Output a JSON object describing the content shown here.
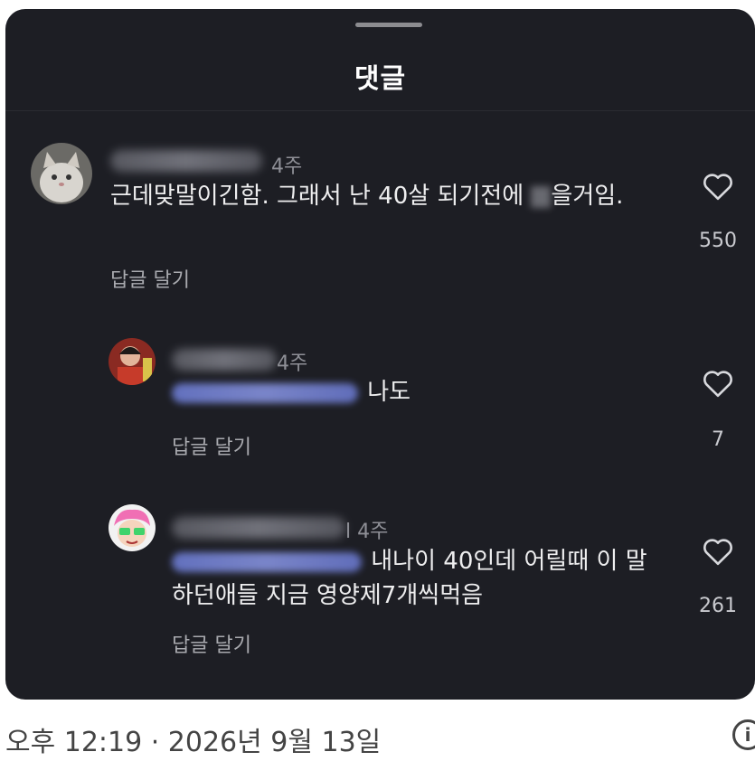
{
  "sheet": {
    "title": "댓글"
  },
  "comments": [
    {
      "time": "4주",
      "text_before": "근데맞말이긴함. 그래서 난 40살 되기전에 ",
      "text_after": "을거임.",
      "reply_label": "답글 달기",
      "likes": "550"
    },
    {
      "time": "4주",
      "text": " 나도",
      "reply_label": "답글 달기",
      "likes": "7"
    },
    {
      "time": "l 4주",
      "text": " 내나이 40인데 어릴때 이 말하던애들 지금 영양제7개씩먹음",
      "reply_label": "답글 달기",
      "likes": "261"
    }
  ],
  "footer": {
    "timestamp": "오후 12:19 · 2026년 9월 13일",
    "info_icon": "i"
  },
  "colors": {
    "sheet_bg": "#1d1e24",
    "mention": "#7f8ddf"
  }
}
